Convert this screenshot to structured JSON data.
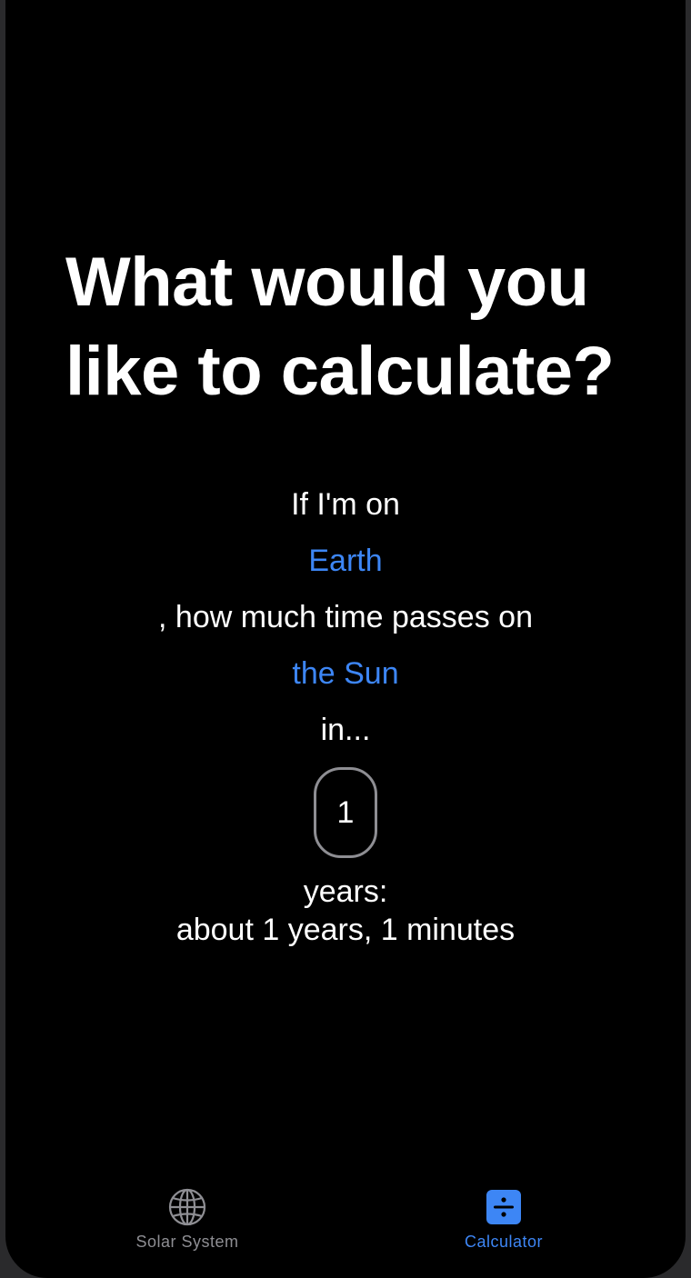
{
  "main": {
    "title_line1": "What would you",
    "title_line2": "like to calculate?",
    "prefix": "If I'm on",
    "origin_planet": "Earth",
    "middle": ", how much time passes on",
    "target_body": "the Sun",
    "in_text": "in...",
    "years_value": "1",
    "years_label": "years:",
    "result": "about 1 years, 1 minutes"
  },
  "tabbar": {
    "tabs": [
      {
        "label": "Solar System",
        "icon": "globe-icon",
        "selected": false
      },
      {
        "label": "Calculator",
        "icon": "divide-icon",
        "selected": true
      }
    ]
  },
  "colors": {
    "accent": "#3d86f5",
    "background": "#000000",
    "inactive": "#8e8e93"
  }
}
